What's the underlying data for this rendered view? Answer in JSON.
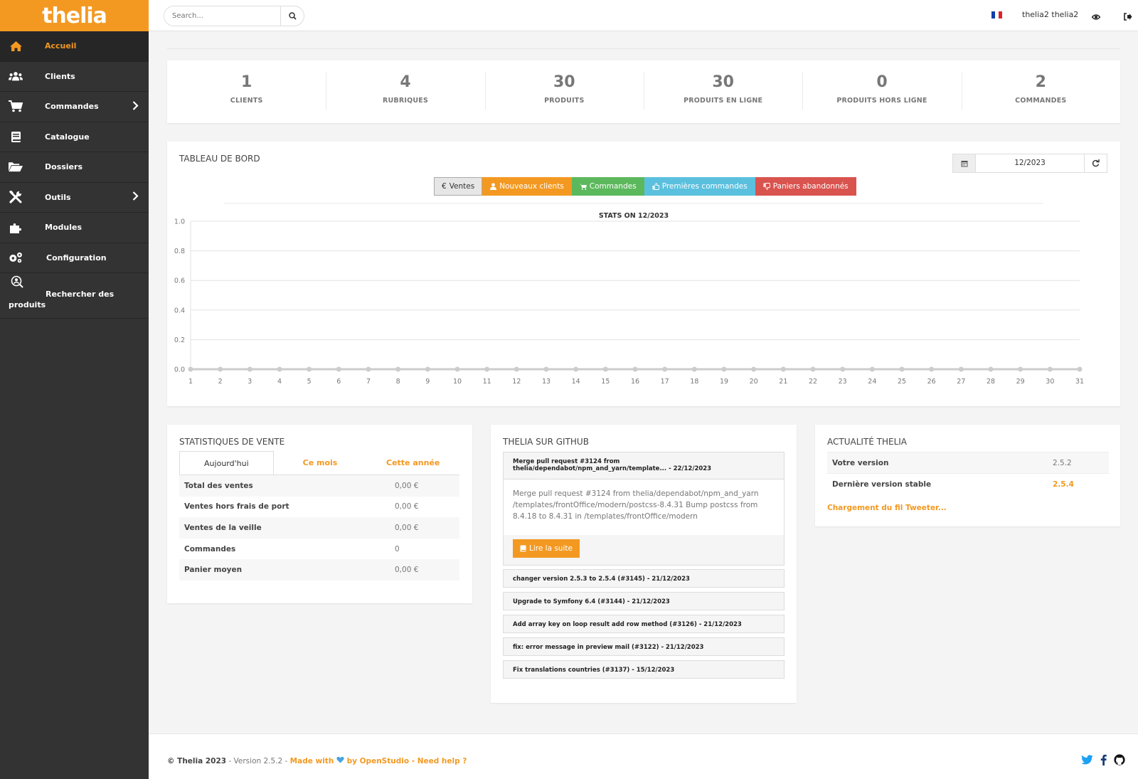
{
  "app": {
    "logo": "thelia"
  },
  "colors": {
    "accent": "#f39922",
    "sidebar": "#333333",
    "success": "#5cb85c",
    "info": "#5bc0de",
    "danger": "#d9534f"
  },
  "sidebar": {
    "items": [
      {
        "label": "Accueil",
        "icon": "home-icon"
      },
      {
        "label": "Clients",
        "icon": "users-icon"
      },
      {
        "label": "Commandes",
        "icon": "cart-icon"
      },
      {
        "label": "Catalogue",
        "icon": "book-icon"
      },
      {
        "label": "Dossiers",
        "icon": "folder-open-icon"
      },
      {
        "label": "Outils",
        "icon": "tools-icon"
      },
      {
        "label": "Modules",
        "icon": "puzzle-icon"
      },
      {
        "label": "Configuration",
        "icon": "cogs-icon"
      },
      {
        "label": "Rechercher des produits",
        "icon": "search-product-icon"
      }
    ]
  },
  "topbar": {
    "search_placeholder": "Search...",
    "user": "thelia2 thelia2",
    "language_flag": "fr"
  },
  "stats": [
    {
      "value": "1",
      "label": "CLIENTS"
    },
    {
      "value": "4",
      "label": "RUBRIQUES"
    },
    {
      "value": "30",
      "label": "PRODUITS"
    },
    {
      "value": "30",
      "label": "PRODUITS EN LIGNE"
    },
    {
      "value": "0",
      "label": "PRODUITS HORS LIGNE"
    },
    {
      "value": "2",
      "label": "COMMANDES"
    }
  ],
  "dashboard": {
    "title": "TABLEAU DE BORD",
    "month": "12/2023",
    "tabs": {
      "ventes": "Ventes",
      "nouveaux_clients": "Nouveaux clients",
      "commandes": "Commandes",
      "premieres_commandes": "Premières commandes",
      "paniers_abandonnes": "Paniers abandonnés"
    }
  },
  "chart_data": {
    "type": "line",
    "title": "STATS ON 12/2023",
    "x": [
      1,
      2,
      3,
      4,
      5,
      6,
      7,
      8,
      9,
      10,
      11,
      12,
      13,
      14,
      15,
      16,
      17,
      18,
      19,
      20,
      21,
      22,
      23,
      24,
      25,
      26,
      27,
      28,
      29,
      30,
      31
    ],
    "series": [
      {
        "values": [
          0,
          0,
          0,
          0,
          0,
          0,
          0,
          0,
          0,
          0,
          0,
          0,
          0,
          0,
          0,
          0,
          0,
          0,
          0,
          0,
          0,
          0,
          0,
          0,
          0,
          0,
          0,
          0,
          0,
          0,
          0
        ]
      }
    ],
    "ylim": [
      0,
      1
    ],
    "yticks": [
      "0.0",
      "0.2",
      "0.4",
      "0.6",
      "0.8",
      "1.0"
    ],
    "grid": true
  },
  "ventes": {
    "title": "STATISTIQUES DE VENTE",
    "tabs": [
      "Aujourd'hui",
      "Ce mois",
      "Cette année"
    ],
    "rows": [
      {
        "label": "Total des ventes",
        "value": "0,00 €"
      },
      {
        "label": "Ventes hors frais de port",
        "value": "0,00 €"
      },
      {
        "label": "Ventes de la veille",
        "value": "0,00 €"
      },
      {
        "label": "Commandes",
        "value": "0"
      },
      {
        "label": "Panier moyen",
        "value": "0,00 €"
      }
    ]
  },
  "github": {
    "title": "THELIA SUR GITHUB",
    "open_item": {
      "header": "Merge pull request #3124 from thelia/dependabot/npm_and_yarn/template... - 22/12/2023",
      "body": "Merge pull request #3124 from thelia/dependabot/npm_and_yarn /templates/frontOffice/modern/postcss-8.4.31 Bump postcss from 8.4.18 to 8.4.31 in /templates/frontOffice/modern",
      "button": "Lire la suite"
    },
    "items": [
      "changer version 2.5.3 to 2.5.4 (#3145) - 21/12/2023",
      "Upgrade to Symfony 6.4 (#3144) - 21/12/2023",
      "Add array key on loop result add row method (#3126) - 21/12/2023",
      "fix: error message in preview mail (#3122) - 21/12/2023",
      "Fix translations countries (#3137) - 15/12/2023"
    ]
  },
  "actu": {
    "title": "ACTUALITÉ THELIA",
    "rows": [
      {
        "label": "Votre version",
        "value": "2.5.2"
      },
      {
        "label": "Dernière version stable",
        "value": "2.5.4"
      }
    ],
    "loading": "Chargement du fil Tweeter..."
  },
  "footer": {
    "copyright": "© Thelia 2023",
    "version": " - Version 2.5.2 - ",
    "made_with": "Made with",
    "by": " by OpenStudio - Need help ?"
  }
}
